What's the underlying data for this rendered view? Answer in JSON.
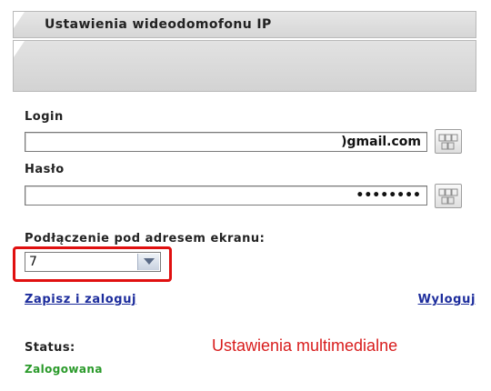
{
  "header": {
    "title": "Ustawienia wideodomofonu IP"
  },
  "login": {
    "label": "Login",
    "value": ")gmail.com"
  },
  "password": {
    "label": "Hasło",
    "value": "••••••••"
  },
  "connection": {
    "label": "Podłączenie pod adresem ekranu:",
    "selected": "7"
  },
  "actions": {
    "save_login": "Zapisz i zaloguj",
    "logout": "Wyloguj"
  },
  "status": {
    "label": "Status:",
    "value": "Zalogowana"
  },
  "annotation": {
    "text": "Ustawienia multimedialne"
  },
  "colors": {
    "highlight": "#e01010",
    "status_ok": "#2a9a2a",
    "link": "#1c2c9c",
    "annotation": "#d81c1c"
  },
  "icons": {
    "keyboard_button": "keyboard-icon",
    "select_arrow": "chevron-down-icon"
  }
}
